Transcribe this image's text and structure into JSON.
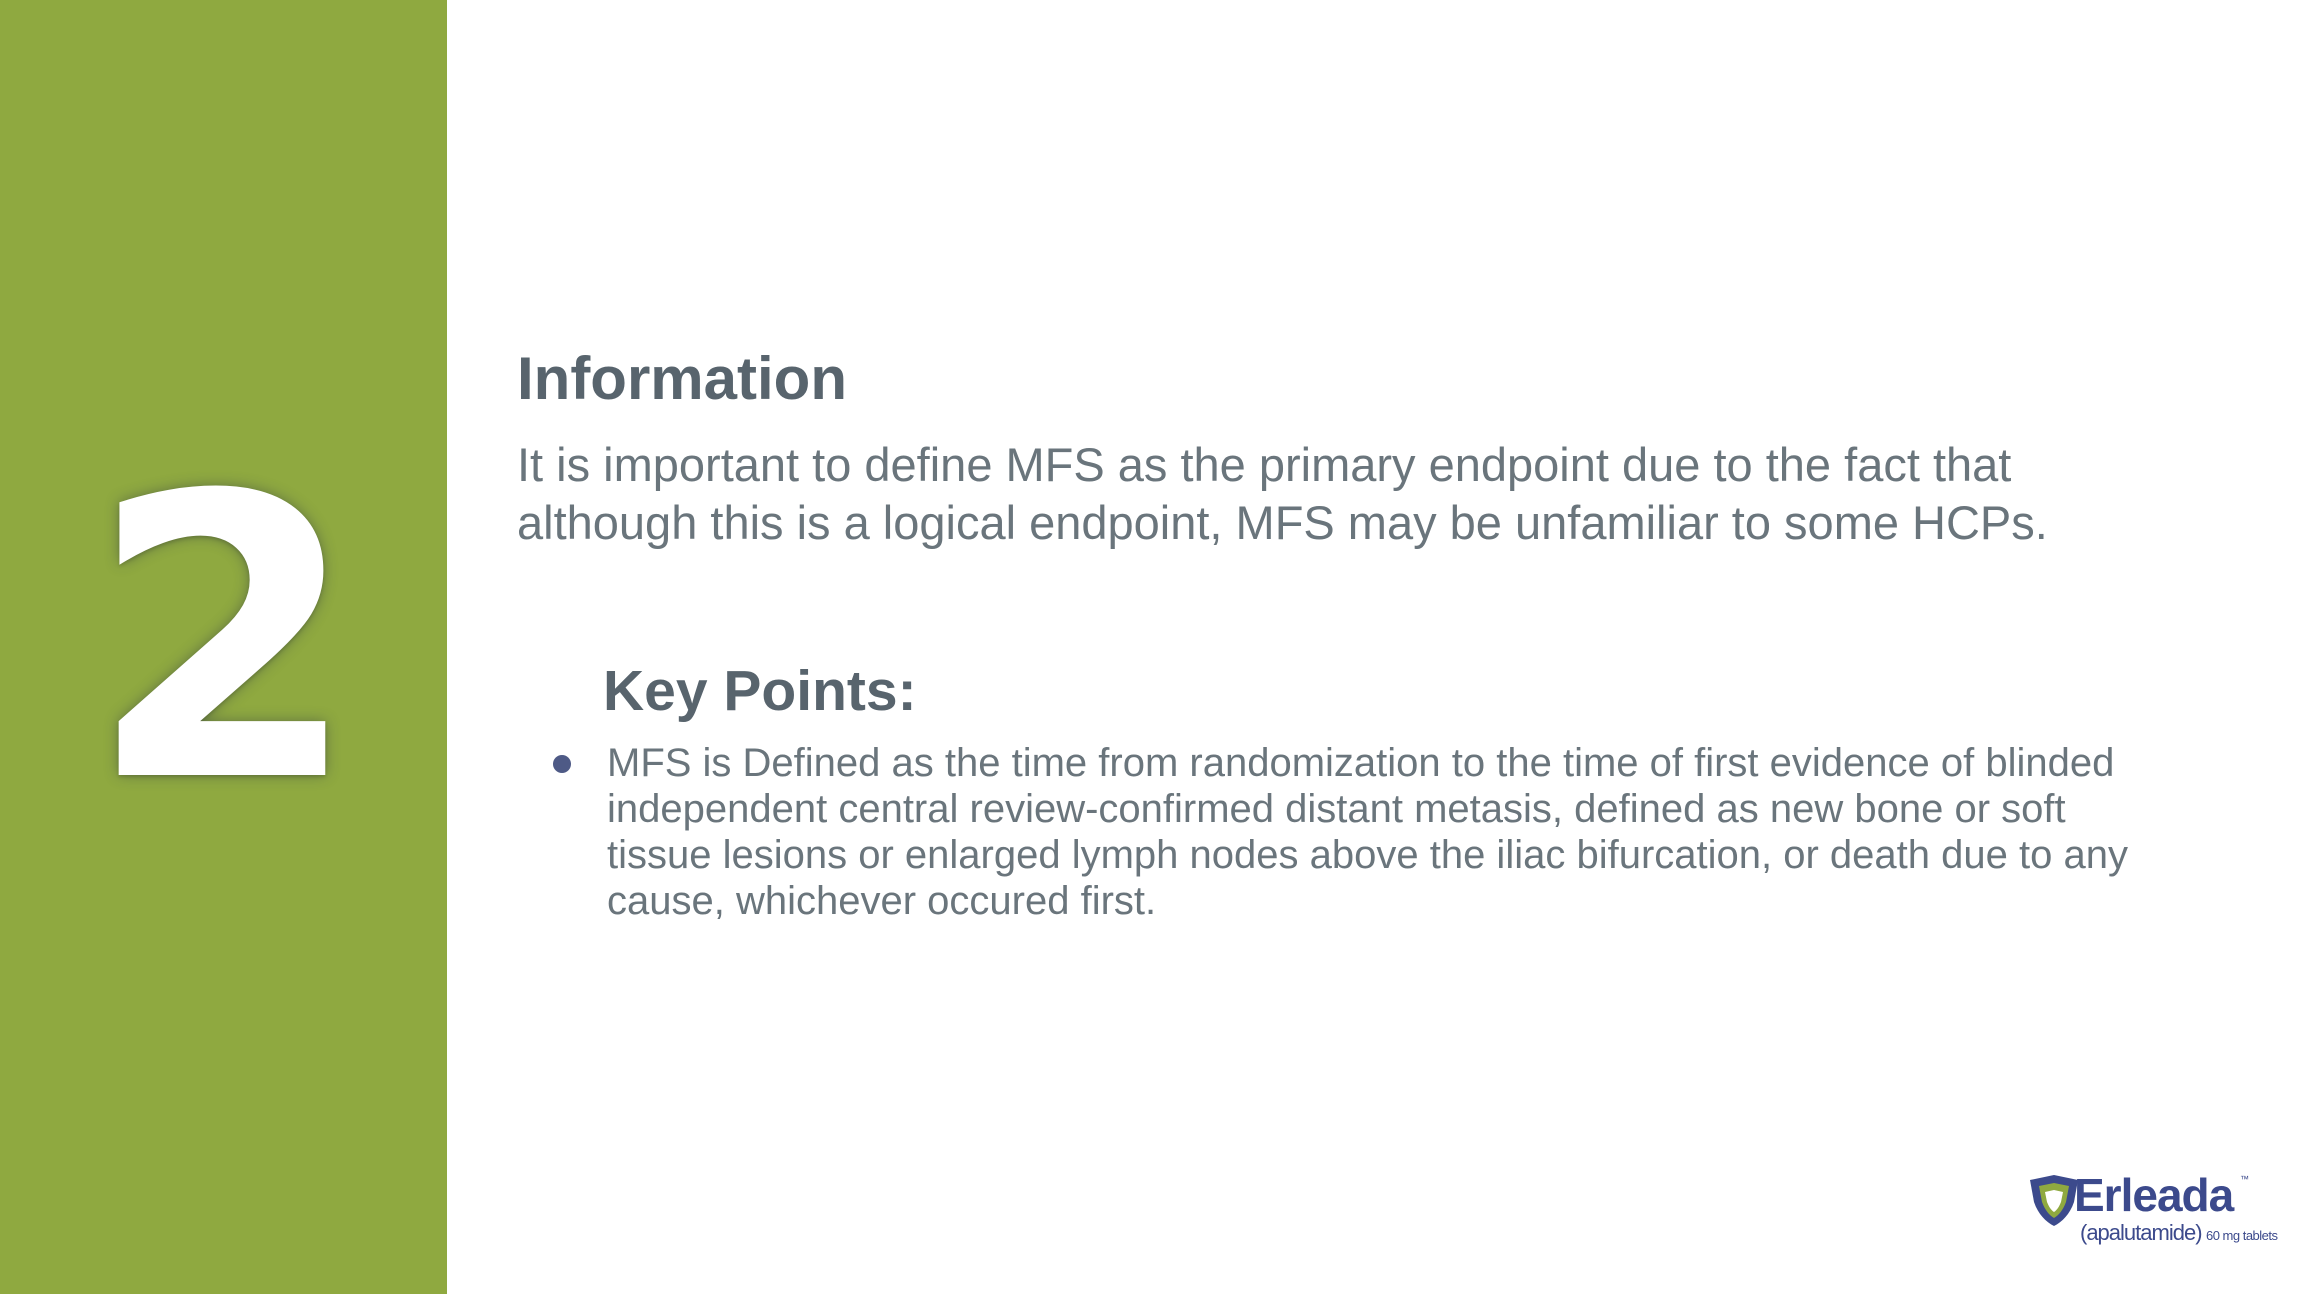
{
  "slide": {
    "number": "2",
    "colors": {
      "sidebar": "#8fa940",
      "heading_text": "#58646d",
      "body_text": "#6a757c",
      "bullet": "#4e5a86",
      "logo": "#3c4a8c"
    }
  },
  "information": {
    "heading": "Information",
    "body": "It is important to define MFS as the primary endpoint due to the fact that although this is a logical endpoint, MFS may be unfamiliar to some HCPs."
  },
  "key_points": {
    "heading": "Key Points:",
    "items": [
      "MFS is Defined as the time from randomization to the time of first evidence of blinded independent central review-confirmed distant metasis, defined as new bone or soft tissue lesions or enlarged lymph nodes above the iliac bifurcation, or death due to any cause, whichever occured first."
    ]
  },
  "logo": {
    "brand": "Erleada",
    "trademark": "™",
    "generic": "(apalutamide)",
    "dose": "60 mg tablets",
    "icon": "shield-icon"
  }
}
